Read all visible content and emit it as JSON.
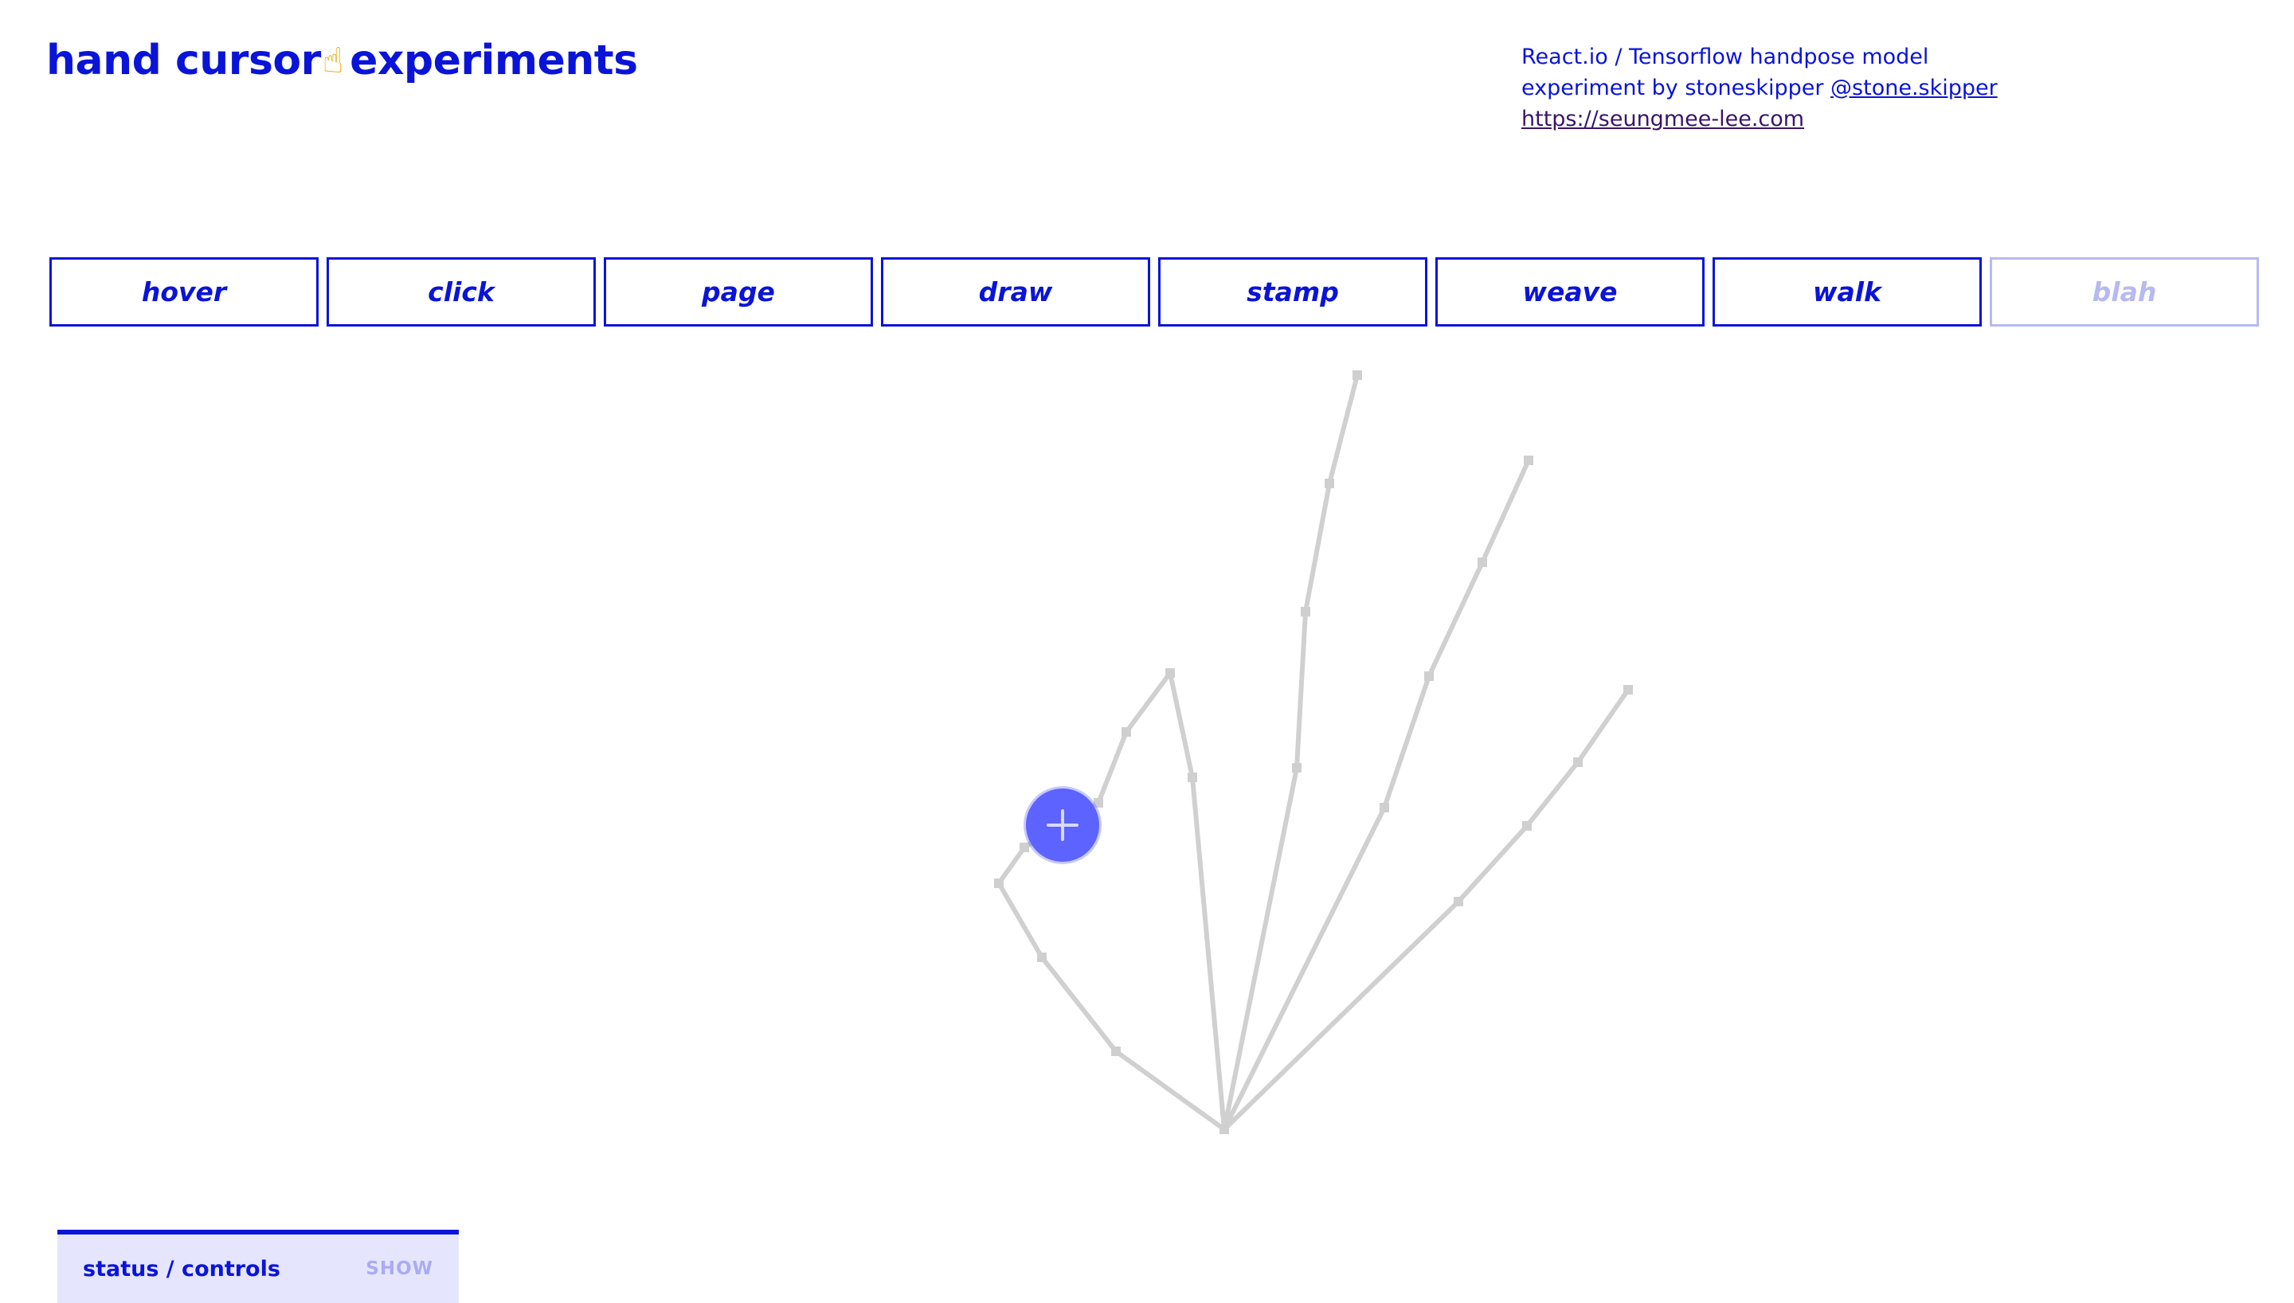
{
  "header": {
    "title_text": "hand cursor",
    "title_emoji": "☝",
    "title_suffix": "experiments"
  },
  "credits": {
    "line1": "React.io / Tensorflow handpose model",
    "line2_prefix": "experiment by stoneskipper ",
    "line2_link": "@stone.skipper",
    "line3_link": "https://seungmee-lee.com"
  },
  "tabs": [
    {
      "label": "hover",
      "enabled": true
    },
    {
      "label": "click",
      "enabled": true
    },
    {
      "label": "page",
      "enabled": true
    },
    {
      "label": "draw",
      "enabled": true
    },
    {
      "label": "stamp",
      "enabled": true
    },
    {
      "label": "weave",
      "enabled": true
    },
    {
      "label": "walk",
      "enabled": true
    },
    {
      "label": "blah",
      "enabled": false
    }
  ],
  "cursor": {
    "icon": "plus-icon",
    "color": "#5c63ff"
  },
  "status_panel": {
    "label": "status / controls",
    "toggle_label": "SHOW"
  },
  "colors": {
    "primary": "#0a14d8",
    "disabled": "#b7b9f2",
    "skeleton": "#d0d0d0",
    "panel_bg": "#e5e6fd"
  }
}
